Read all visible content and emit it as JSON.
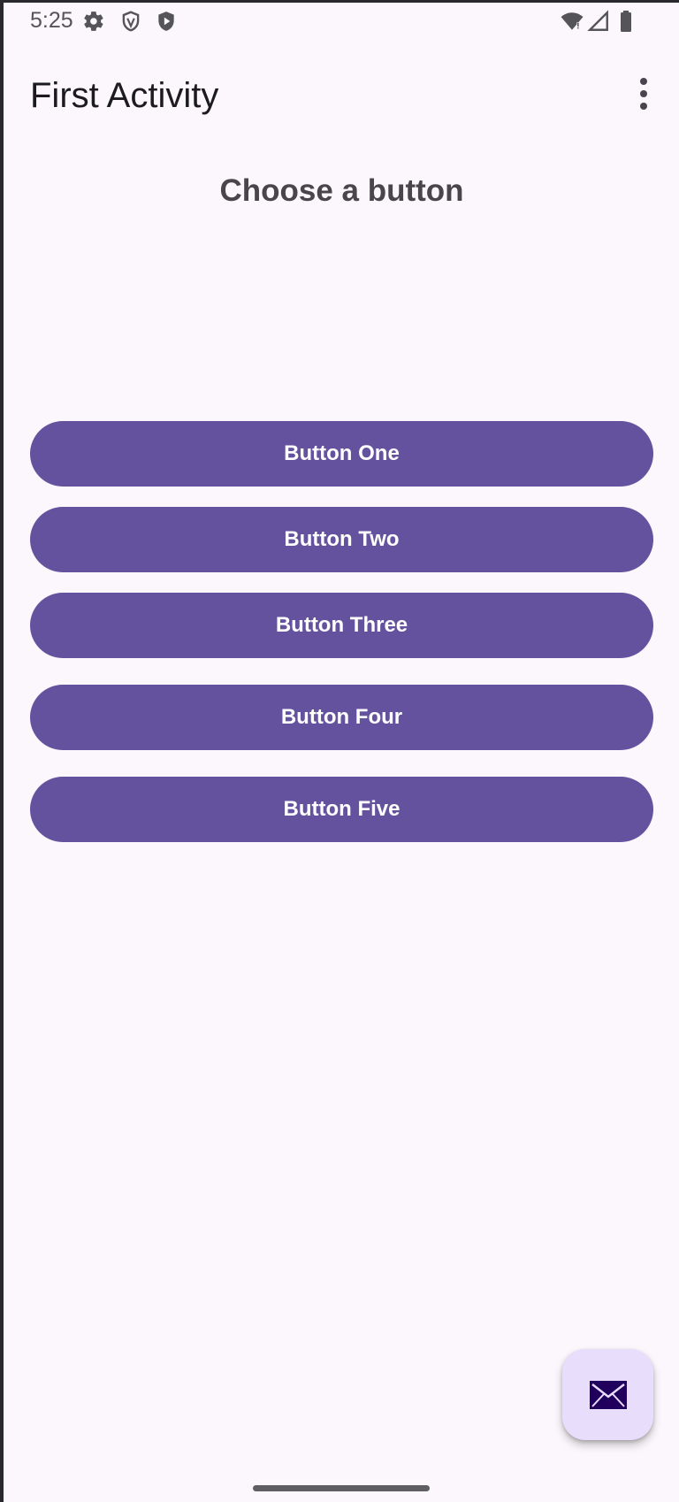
{
  "status_bar": {
    "time": "5:25",
    "left_icons": [
      "gear-icon",
      "shield-outline-icon",
      "shield-play-icon"
    ],
    "right_icons": [
      "wifi-icon",
      "cellular-signal-icon",
      "battery-icon"
    ]
  },
  "app_bar": {
    "title": "First Activity",
    "overflow_icon": "more-vert-icon"
  },
  "main": {
    "heading": "Choose a button",
    "buttons": [
      {
        "label": "Button One"
      },
      {
        "label": "Button Two"
      },
      {
        "label": "Button Three"
      },
      {
        "label": "Button Four"
      },
      {
        "label": "Button Five"
      }
    ]
  },
  "fab": {
    "icon": "mail-icon"
  },
  "colors": {
    "background": "#FCF7FC",
    "button": "#65529F",
    "button_text": "#FFFFFF",
    "fab": "#E9DDFC",
    "fab_icon": "#21005D",
    "heading": "#48464C"
  }
}
